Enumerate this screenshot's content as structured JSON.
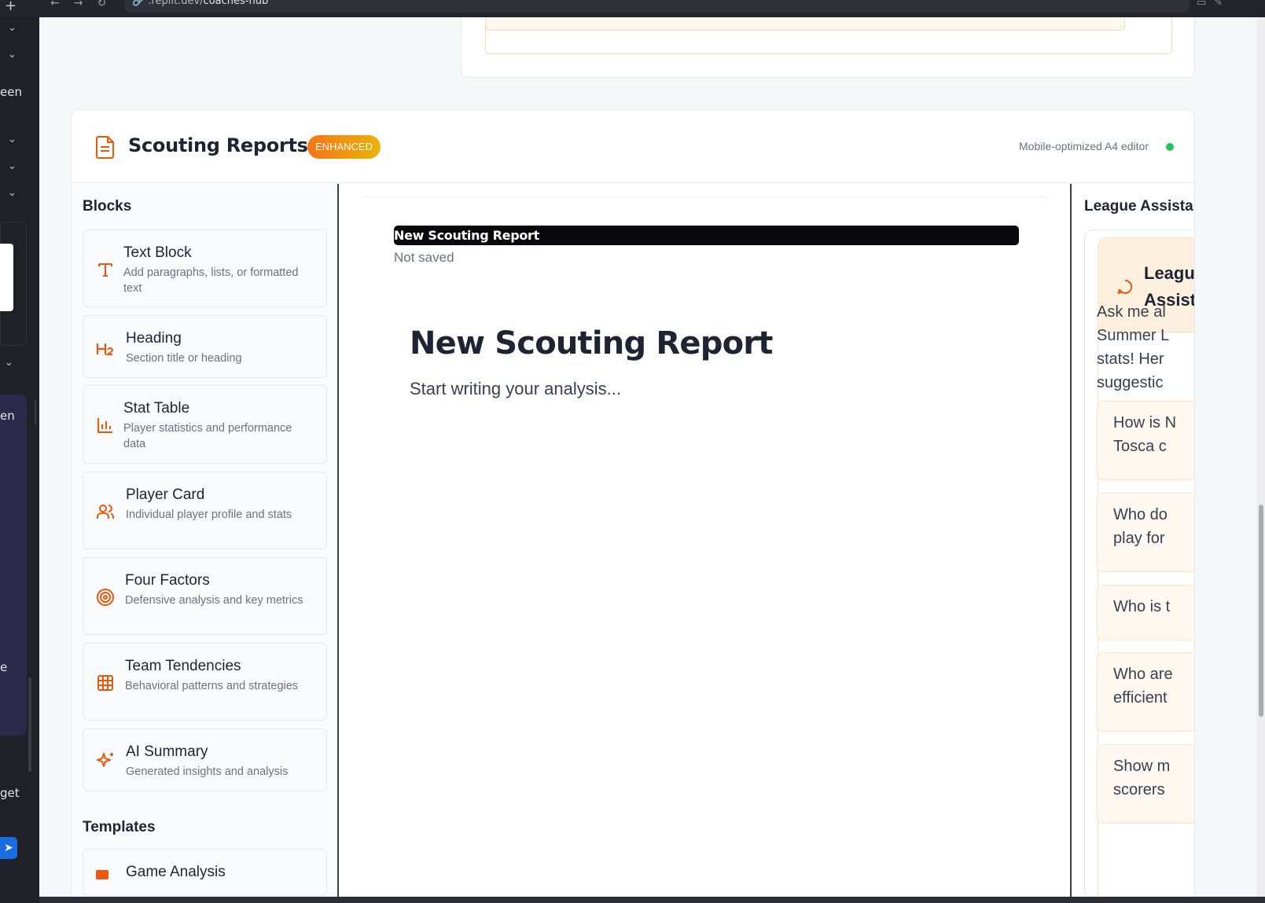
{
  "browser": {
    "url_prefix": ".replit.dev/",
    "url_path": "coaches-hub",
    "new_tab_icon": "plus-icon"
  },
  "left_pane": {
    "fragments": [
      "een",
      "en",
      "e",
      "get"
    ],
    "send_icon": "send-icon"
  },
  "section": {
    "title": "Scouting Reports",
    "badge": "ENHANCED",
    "status_text": "Mobile-optimized A4 editor",
    "status_color": "#22c55e",
    "accent_color": "#ea580c"
  },
  "blocks": {
    "title": "Blocks",
    "items": [
      {
        "name": "Text Block",
        "desc": "Add paragraphs, lists, or formatted text",
        "icon": "text-icon"
      },
      {
        "name": "Heading",
        "desc": "Section title or heading",
        "icon": "heading-icon"
      },
      {
        "name": "Stat Table",
        "desc": "Player statistics and performance data",
        "icon": "bar-chart-icon"
      },
      {
        "name": "Player Card",
        "desc": "Individual player profile and stats",
        "icon": "users-icon"
      },
      {
        "name": "Four Factors",
        "desc": "Defensive analysis and key metrics",
        "icon": "target-icon"
      },
      {
        "name": "Team Tendencies",
        "desc": "Behavioral patterns and strategies",
        "icon": "grid-icon"
      },
      {
        "name": "AI Summary",
        "desc": "Generated insights and analysis",
        "icon": "sparkles-icon"
      }
    ],
    "templates_title": "Templates",
    "templates": [
      {
        "name": "Game Analysis"
      }
    ]
  },
  "editor": {
    "title_value": "New Scouting Report",
    "save_status": "Not saved",
    "heading": "New Scouting Report",
    "placeholder": "Start writing your analysis..."
  },
  "assistant": {
    "title": "League Assista",
    "card_title_line1": "Leagu",
    "card_title_line2": "Assist",
    "intro_lines": [
      "Ask me al",
      "Summer L",
      "stats! Her",
      "suggestic"
    ],
    "suggestions": [
      {
        "line1": "How is N",
        "line2": "Tosca c"
      },
      {
        "line1": "Who do",
        "line2": "play for"
      },
      {
        "line1": "Who is t",
        "line2": ""
      },
      {
        "line1": "Who are",
        "line2": "efficient"
      },
      {
        "line1": "Show m",
        "line2": "scorers"
      }
    ]
  }
}
